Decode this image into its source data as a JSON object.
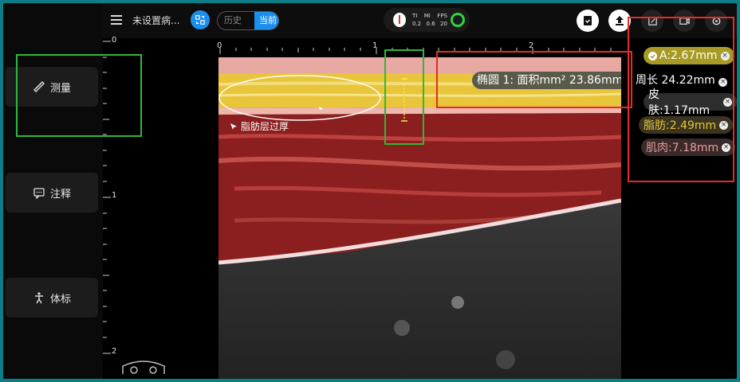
{
  "topbar": {
    "title": "未设置病...",
    "history_label": "历史",
    "current_label": "当前",
    "indicator": {
      "ti_label": "TI",
      "mi_label": "MI",
      "fps_label": "FPS",
      "ti_value": "0.2",
      "mi_value": "0.6",
      "fps_value": "20"
    }
  },
  "sidebar": {
    "items": [
      {
        "label": "测量",
        "icon": "ruler-pencil-icon"
      },
      {
        "label": "注释",
        "icon": "comment-icon"
      },
      {
        "label": "体标",
        "icon": "body-mark-icon"
      }
    ]
  },
  "rulers": {
    "vertical": [
      "0",
      "1",
      "2"
    ],
    "horizontal": [
      "0",
      "1",
      "2"
    ],
    "caliper_label": "A"
  },
  "image": {
    "annotation_text": "脂肪层过厚",
    "measurement_text": "椭圆 1: 面积mm² 23.86mm",
    "perimeter_text": "周长 24.22mm"
  },
  "results": {
    "a_value": "A:2.67mm",
    "skin": "皮肤:1.17mm",
    "fat": "脂肪:2.49mm",
    "muscle": "肌肉:7.18mm"
  },
  "colors": {
    "accent": "#1b8ff0",
    "fat_yellow": "#e8c53a",
    "muscle_red": "#8b1e1e",
    "annotation_green": "#2db936",
    "annotation_red": "#e42a2a"
  }
}
